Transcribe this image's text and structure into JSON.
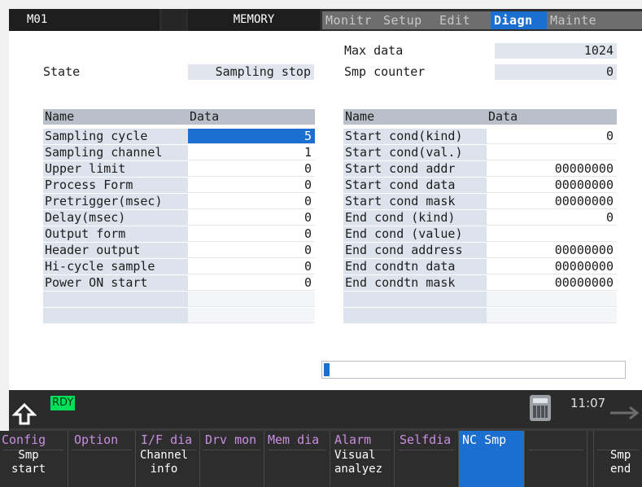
{
  "topbar": {
    "mode": "M01",
    "memory": "MEMORY",
    "tabs": [
      "Monitr",
      "Setup",
      "Edit",
      "Diagn",
      "Mainte"
    ],
    "active_tab": "Diagn"
  },
  "state": {
    "label": "State",
    "value": "Sampling stop"
  },
  "max_data": {
    "label": "Max data",
    "value": "1024"
  },
  "smp_counter": {
    "label": "Smp counter",
    "value": "0"
  },
  "left_table": {
    "headers": [
      "Name",
      "Data"
    ],
    "rows": [
      {
        "name": "Sampling cycle",
        "value": "5"
      },
      {
        "name": "Sampling channel",
        "value": "1"
      },
      {
        "name": "Upper limit",
        "value": "0"
      },
      {
        "name": "Process Form",
        "value": "0"
      },
      {
        "name": "Pretrigger(msec)",
        "value": "0"
      },
      {
        "name": "Delay(msec)",
        "value": "0"
      },
      {
        "name": "Output form",
        "value": "0"
      },
      {
        "name": "Header output",
        "value": "0"
      },
      {
        "name": "Hi-cycle sample",
        "value": "0"
      },
      {
        "name": "Power ON start",
        "value": "0"
      },
      {
        "name": "",
        "value": ""
      },
      {
        "name": "",
        "value": ""
      }
    ]
  },
  "right_table": {
    "headers": [
      "Name",
      "Data"
    ],
    "rows": [
      {
        "name": "Start cond(kind)",
        "value": "0"
      },
      {
        "name": "Start cond(val.)",
        "value": ""
      },
      {
        "name": "Start cond addr",
        "value": "00000000"
      },
      {
        "name": "Start cond data",
        "value": "00000000"
      },
      {
        "name": "Start cond mask",
        "value": "00000000"
      },
      {
        "name": "End cond (kind)",
        "value": "0"
      },
      {
        "name": "End cond (value)",
        "value": ""
      },
      {
        "name": "End cond address",
        "value": "00000000"
      },
      {
        "name": "End condtn data",
        "value": "00000000"
      },
      {
        "name": "End condtn mask",
        "value": "00000000"
      },
      {
        "name": "",
        "value": ""
      },
      {
        "name": "",
        "value": ""
      }
    ]
  },
  "progress": {
    "fraction": 0.02
  },
  "status": {
    "ready": "RDY",
    "clock": "11:07",
    "icons": [
      "home-arrow-icon",
      "calculator-icon",
      "next-page-arrow-icon"
    ]
  },
  "menu": [
    {
      "top": "Config",
      "bottom": "Smp\nstart"
    },
    {
      "top": "Option",
      "bottom": ""
    },
    {
      "top": "I/F dia",
      "bottom": "Channel\ninfo"
    },
    {
      "top": "Drv mon",
      "bottom": ""
    },
    {
      "top": "Mem dia",
      "bottom": ""
    },
    {
      "top": "Alarm",
      "bottom": "Visual\nanalyez"
    },
    {
      "top": "Selfdia",
      "bottom": ""
    },
    {
      "top": "NC Smp",
      "bottom": ""
    },
    {
      "top": "",
      "bottom": ""
    },
    {
      "top": "",
      "bottom": ""
    },
    {
      "top": "",
      "bottom": "Smp\nend"
    }
  ],
  "colors": {
    "accent": "#1a6fd0",
    "ready": "#00e05a",
    "menu_text": "#c98ee0",
    "header_bg": "#b9c0c9",
    "name_bg": "#dde3ec"
  }
}
